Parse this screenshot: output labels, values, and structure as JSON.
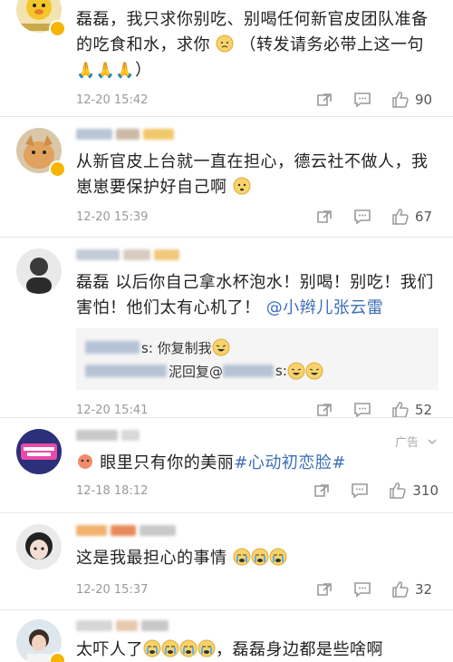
{
  "comments": [
    {
      "text": "磊磊，我只求你别吃、别喝任何新官皮团队准备的吃食和水，求你",
      "text_tail": "（转发请务必带上这一句",
      "time": "12-20 15:42",
      "likes": "90"
    },
    {
      "text": "从新官皮上台就一直在担心，德云社不做人，我崽崽要保护好自己啊",
      "time": "12-20 15:39",
      "likes": "67"
    },
    {
      "text": "磊磊 以后你自己拿水杯泡水！别喝！别吃！我们害怕！他们太有心机了！",
      "mention": "@小辫儿张云雷",
      "subreplies": [
        {
          "text": "s: 你复制我"
        },
        {
          "mid": "泥回复@",
          "text": "s:"
        }
      ],
      "time": "12-20 15:41",
      "likes": "52"
    },
    {
      "ad": "广告",
      "text": "眼里只有你的美丽",
      "topic": "#心动初恋脸#",
      "time": "12-18 18:12",
      "likes": "310"
    },
    {
      "text": "这是我最担心的事情",
      "time": "12-20 15:37",
      "likes": "32"
    },
    {
      "text_a": "太吓人了",
      "text_b": "，磊磊身边都是些啥啊"
    }
  ],
  "icons": [
    "repost-icon",
    "comment-icon",
    "like-icon",
    "chevron-down-icon"
  ],
  "colors": {
    "link": "#3b6fb6",
    "meta": "#9a9a9a",
    "badge": "#f6b500"
  }
}
